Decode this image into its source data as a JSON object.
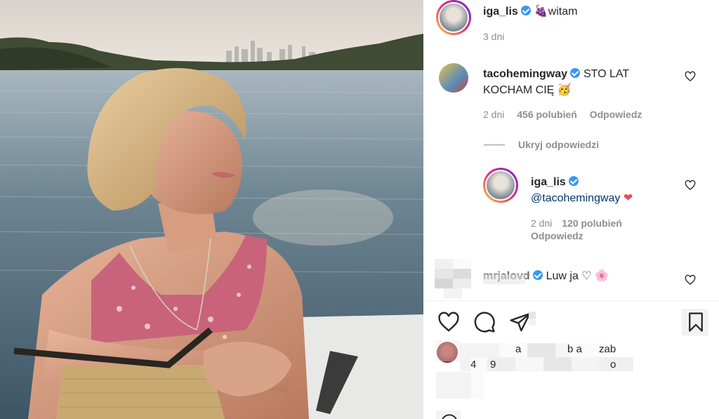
{
  "post": {
    "author": "iga_lis",
    "caption_emoji": "🍇",
    "caption": "witam",
    "time": "3 dni"
  },
  "comments": [
    {
      "user": "tacohemingway",
      "text_line1": "STO LAT",
      "text_line2": "KOCHAM CIĘ",
      "emoji": "🥳",
      "time": "2 dni",
      "likes": "456 polubień",
      "reply_label": "Odpowiedz",
      "toggle_replies": "Ukryj odpowiedzi"
    }
  ],
  "reply": {
    "user": "iga_lis",
    "mention": "@tacohemingway",
    "emoji": "❤",
    "time": "2 dni",
    "likes": "120 polubień",
    "reply_label": "Odpowiedz"
  },
  "comment3": {
    "user": "mrjalovd",
    "text": "Luw ja",
    "emoji_heart": "♡",
    "emoji_flower": "🌸"
  },
  "likes_row": {
    "frag1": "a",
    "frag2": "b a",
    "frag3": "zab",
    "frag4": "4",
    "frag5": "9",
    "frag6": "o"
  },
  "icons": {
    "like": "heart-outline-icon",
    "comment": "comment-bubble-icon",
    "share": "paper-plane-icon",
    "save": "bookmark-icon"
  },
  "colors": {
    "verified": "#3897f0",
    "heart_red": "#ed4956",
    "mention": "#00376b"
  }
}
